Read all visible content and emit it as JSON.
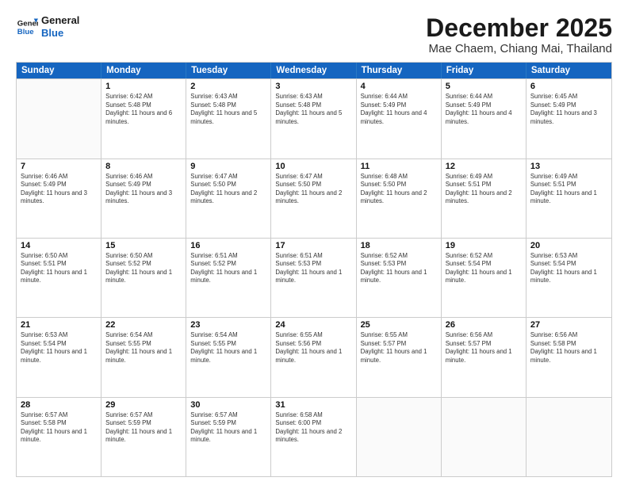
{
  "header": {
    "logo_line1": "General",
    "logo_line2": "Blue",
    "month": "December 2025",
    "location": "Mae Chaem, Chiang Mai, Thailand"
  },
  "weekdays": [
    "Sunday",
    "Monday",
    "Tuesday",
    "Wednesday",
    "Thursday",
    "Friday",
    "Saturday"
  ],
  "rows": [
    [
      {
        "day": "",
        "sunrise": "",
        "sunset": "",
        "daylight": ""
      },
      {
        "day": "1",
        "sunrise": "Sunrise: 6:42 AM",
        "sunset": "Sunset: 5:48 PM",
        "daylight": "Daylight: 11 hours and 6 minutes."
      },
      {
        "day": "2",
        "sunrise": "Sunrise: 6:43 AM",
        "sunset": "Sunset: 5:48 PM",
        "daylight": "Daylight: 11 hours and 5 minutes."
      },
      {
        "day": "3",
        "sunrise": "Sunrise: 6:43 AM",
        "sunset": "Sunset: 5:48 PM",
        "daylight": "Daylight: 11 hours and 5 minutes."
      },
      {
        "day": "4",
        "sunrise": "Sunrise: 6:44 AM",
        "sunset": "Sunset: 5:49 PM",
        "daylight": "Daylight: 11 hours and 4 minutes."
      },
      {
        "day": "5",
        "sunrise": "Sunrise: 6:44 AM",
        "sunset": "Sunset: 5:49 PM",
        "daylight": "Daylight: 11 hours and 4 minutes."
      },
      {
        "day": "6",
        "sunrise": "Sunrise: 6:45 AM",
        "sunset": "Sunset: 5:49 PM",
        "daylight": "Daylight: 11 hours and 3 minutes."
      }
    ],
    [
      {
        "day": "7",
        "sunrise": "Sunrise: 6:46 AM",
        "sunset": "Sunset: 5:49 PM",
        "daylight": "Daylight: 11 hours and 3 minutes."
      },
      {
        "day": "8",
        "sunrise": "Sunrise: 6:46 AM",
        "sunset": "Sunset: 5:49 PM",
        "daylight": "Daylight: 11 hours and 3 minutes."
      },
      {
        "day": "9",
        "sunrise": "Sunrise: 6:47 AM",
        "sunset": "Sunset: 5:50 PM",
        "daylight": "Daylight: 11 hours and 2 minutes."
      },
      {
        "day": "10",
        "sunrise": "Sunrise: 6:47 AM",
        "sunset": "Sunset: 5:50 PM",
        "daylight": "Daylight: 11 hours and 2 minutes."
      },
      {
        "day": "11",
        "sunrise": "Sunrise: 6:48 AM",
        "sunset": "Sunset: 5:50 PM",
        "daylight": "Daylight: 11 hours and 2 minutes."
      },
      {
        "day": "12",
        "sunrise": "Sunrise: 6:49 AM",
        "sunset": "Sunset: 5:51 PM",
        "daylight": "Daylight: 11 hours and 2 minutes."
      },
      {
        "day": "13",
        "sunrise": "Sunrise: 6:49 AM",
        "sunset": "Sunset: 5:51 PM",
        "daylight": "Daylight: 11 hours and 1 minute."
      }
    ],
    [
      {
        "day": "14",
        "sunrise": "Sunrise: 6:50 AM",
        "sunset": "Sunset: 5:51 PM",
        "daylight": "Daylight: 11 hours and 1 minute."
      },
      {
        "day": "15",
        "sunrise": "Sunrise: 6:50 AM",
        "sunset": "Sunset: 5:52 PM",
        "daylight": "Daylight: 11 hours and 1 minute."
      },
      {
        "day": "16",
        "sunrise": "Sunrise: 6:51 AM",
        "sunset": "Sunset: 5:52 PM",
        "daylight": "Daylight: 11 hours and 1 minute."
      },
      {
        "day": "17",
        "sunrise": "Sunrise: 6:51 AM",
        "sunset": "Sunset: 5:53 PM",
        "daylight": "Daylight: 11 hours and 1 minute."
      },
      {
        "day": "18",
        "sunrise": "Sunrise: 6:52 AM",
        "sunset": "Sunset: 5:53 PM",
        "daylight": "Daylight: 11 hours and 1 minute."
      },
      {
        "day": "19",
        "sunrise": "Sunrise: 6:52 AM",
        "sunset": "Sunset: 5:54 PM",
        "daylight": "Daylight: 11 hours and 1 minute."
      },
      {
        "day": "20",
        "sunrise": "Sunrise: 6:53 AM",
        "sunset": "Sunset: 5:54 PM",
        "daylight": "Daylight: 11 hours and 1 minute."
      }
    ],
    [
      {
        "day": "21",
        "sunrise": "Sunrise: 6:53 AM",
        "sunset": "Sunset: 5:54 PM",
        "daylight": "Daylight: 11 hours and 1 minute."
      },
      {
        "day": "22",
        "sunrise": "Sunrise: 6:54 AM",
        "sunset": "Sunset: 5:55 PM",
        "daylight": "Daylight: 11 hours and 1 minute."
      },
      {
        "day": "23",
        "sunrise": "Sunrise: 6:54 AM",
        "sunset": "Sunset: 5:55 PM",
        "daylight": "Daylight: 11 hours and 1 minute."
      },
      {
        "day": "24",
        "sunrise": "Sunrise: 6:55 AM",
        "sunset": "Sunset: 5:56 PM",
        "daylight": "Daylight: 11 hours and 1 minute."
      },
      {
        "day": "25",
        "sunrise": "Sunrise: 6:55 AM",
        "sunset": "Sunset: 5:57 PM",
        "daylight": "Daylight: 11 hours and 1 minute."
      },
      {
        "day": "26",
        "sunrise": "Sunrise: 6:56 AM",
        "sunset": "Sunset: 5:57 PM",
        "daylight": "Daylight: 11 hours and 1 minute."
      },
      {
        "day": "27",
        "sunrise": "Sunrise: 6:56 AM",
        "sunset": "Sunset: 5:58 PM",
        "daylight": "Daylight: 11 hours and 1 minute."
      }
    ],
    [
      {
        "day": "28",
        "sunrise": "Sunrise: 6:57 AM",
        "sunset": "Sunset: 5:58 PM",
        "daylight": "Daylight: 11 hours and 1 minute."
      },
      {
        "day": "29",
        "sunrise": "Sunrise: 6:57 AM",
        "sunset": "Sunset: 5:59 PM",
        "daylight": "Daylight: 11 hours and 1 minute."
      },
      {
        "day": "30",
        "sunrise": "Sunrise: 6:57 AM",
        "sunset": "Sunset: 5:59 PM",
        "daylight": "Daylight: 11 hours and 1 minute."
      },
      {
        "day": "31",
        "sunrise": "Sunrise: 6:58 AM",
        "sunset": "Sunset: 6:00 PM",
        "daylight": "Daylight: 11 hours and 2 minutes."
      },
      {
        "day": "",
        "sunrise": "",
        "sunset": "",
        "daylight": ""
      },
      {
        "day": "",
        "sunrise": "",
        "sunset": "",
        "daylight": ""
      },
      {
        "day": "",
        "sunrise": "",
        "sunset": "",
        "daylight": ""
      }
    ]
  ]
}
